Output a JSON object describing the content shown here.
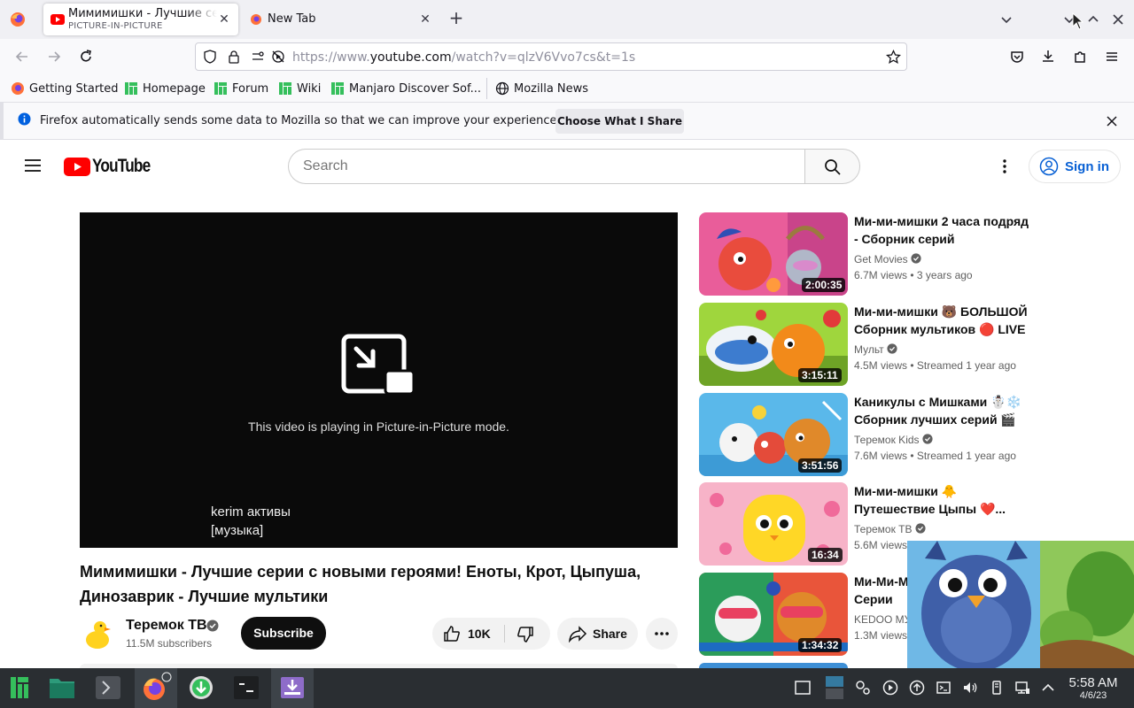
{
  "browser": {
    "tabs": [
      {
        "title": "Мимимишки - Лучшие серии",
        "subtitle": "PICTURE-IN-PICTURE"
      },
      {
        "title": "New Tab"
      }
    ],
    "url_prefix": "https://www.",
    "url_host": "youtube.com",
    "url_rest": "/watch?v=qlzV6Vvo7cs&t=1s",
    "bookmarks": [
      "Getting Started",
      "Homepage",
      "Forum",
      "Wiki",
      "Manjaro Discover Sof...",
      "Mozilla News"
    ],
    "notification": {
      "text": "Firefox automatically sends some data to Mozilla so that we can improve your experience.",
      "button": "Choose What I Share"
    }
  },
  "youtube": {
    "logo_text": "YouTube",
    "search_placeholder": "Search",
    "sign_in": "Sign in",
    "player": {
      "pip_message": "This video is playing in Picture-in-Picture mode.",
      "captions": [
        "kerim активы",
        "[музыка]"
      ]
    },
    "video": {
      "title": "Мимимишки - Лучшие серии с новыми героями! Еноты, Крот, Цыпуша, Динозаврик - Лучшие мультики",
      "channel": "Теремок ТВ",
      "subscribers": "11.5M subscribers",
      "subscribe_label": "Subscribe",
      "likes": "10K",
      "share_label": "Share"
    },
    "recommendations": [
      {
        "title": "Ми-ми-мишки 2 часа подряд - Сборник серий",
        "channel": "Get Movies",
        "meta": "6.7M views • 3 years ago",
        "duration": "2:00:35"
      },
      {
        "title": "Ми-ми-мишки 🐻 БОЛЬШОЙ Сборник мультиков 🔴 LIVE",
        "channel": "Мульт",
        "meta": "4.5M views • Streamed 1 year ago",
        "duration": "3:15:11"
      },
      {
        "title": "Каникулы с Мишками ☃️❄️ Сборник лучших серий 🎬 М...",
        "channel": "Теремок Kids",
        "meta": "7.6M views • Streamed 1 year ago",
        "duration": "3:51:56"
      },
      {
        "title": "Ми-ми-мишки 🐥 Путешествие Цыпы ❤️...",
        "channel": "Теремок ТВ",
        "meta": "5.6M views",
        "duration": "16:34"
      },
      {
        "title": "Ми-Ми-М Серии ❤️",
        "channel": "KEDOO МУ",
        "meta": "1.3M views",
        "duration": "1:34:32"
      }
    ]
  },
  "taskbar": {
    "time": "5:58 AM",
    "date": "4/6/23"
  },
  "colors": {
    "youtube_red": "#ff0000",
    "link_blue": "#065fd4",
    "taskbar": "#2a2e32"
  }
}
